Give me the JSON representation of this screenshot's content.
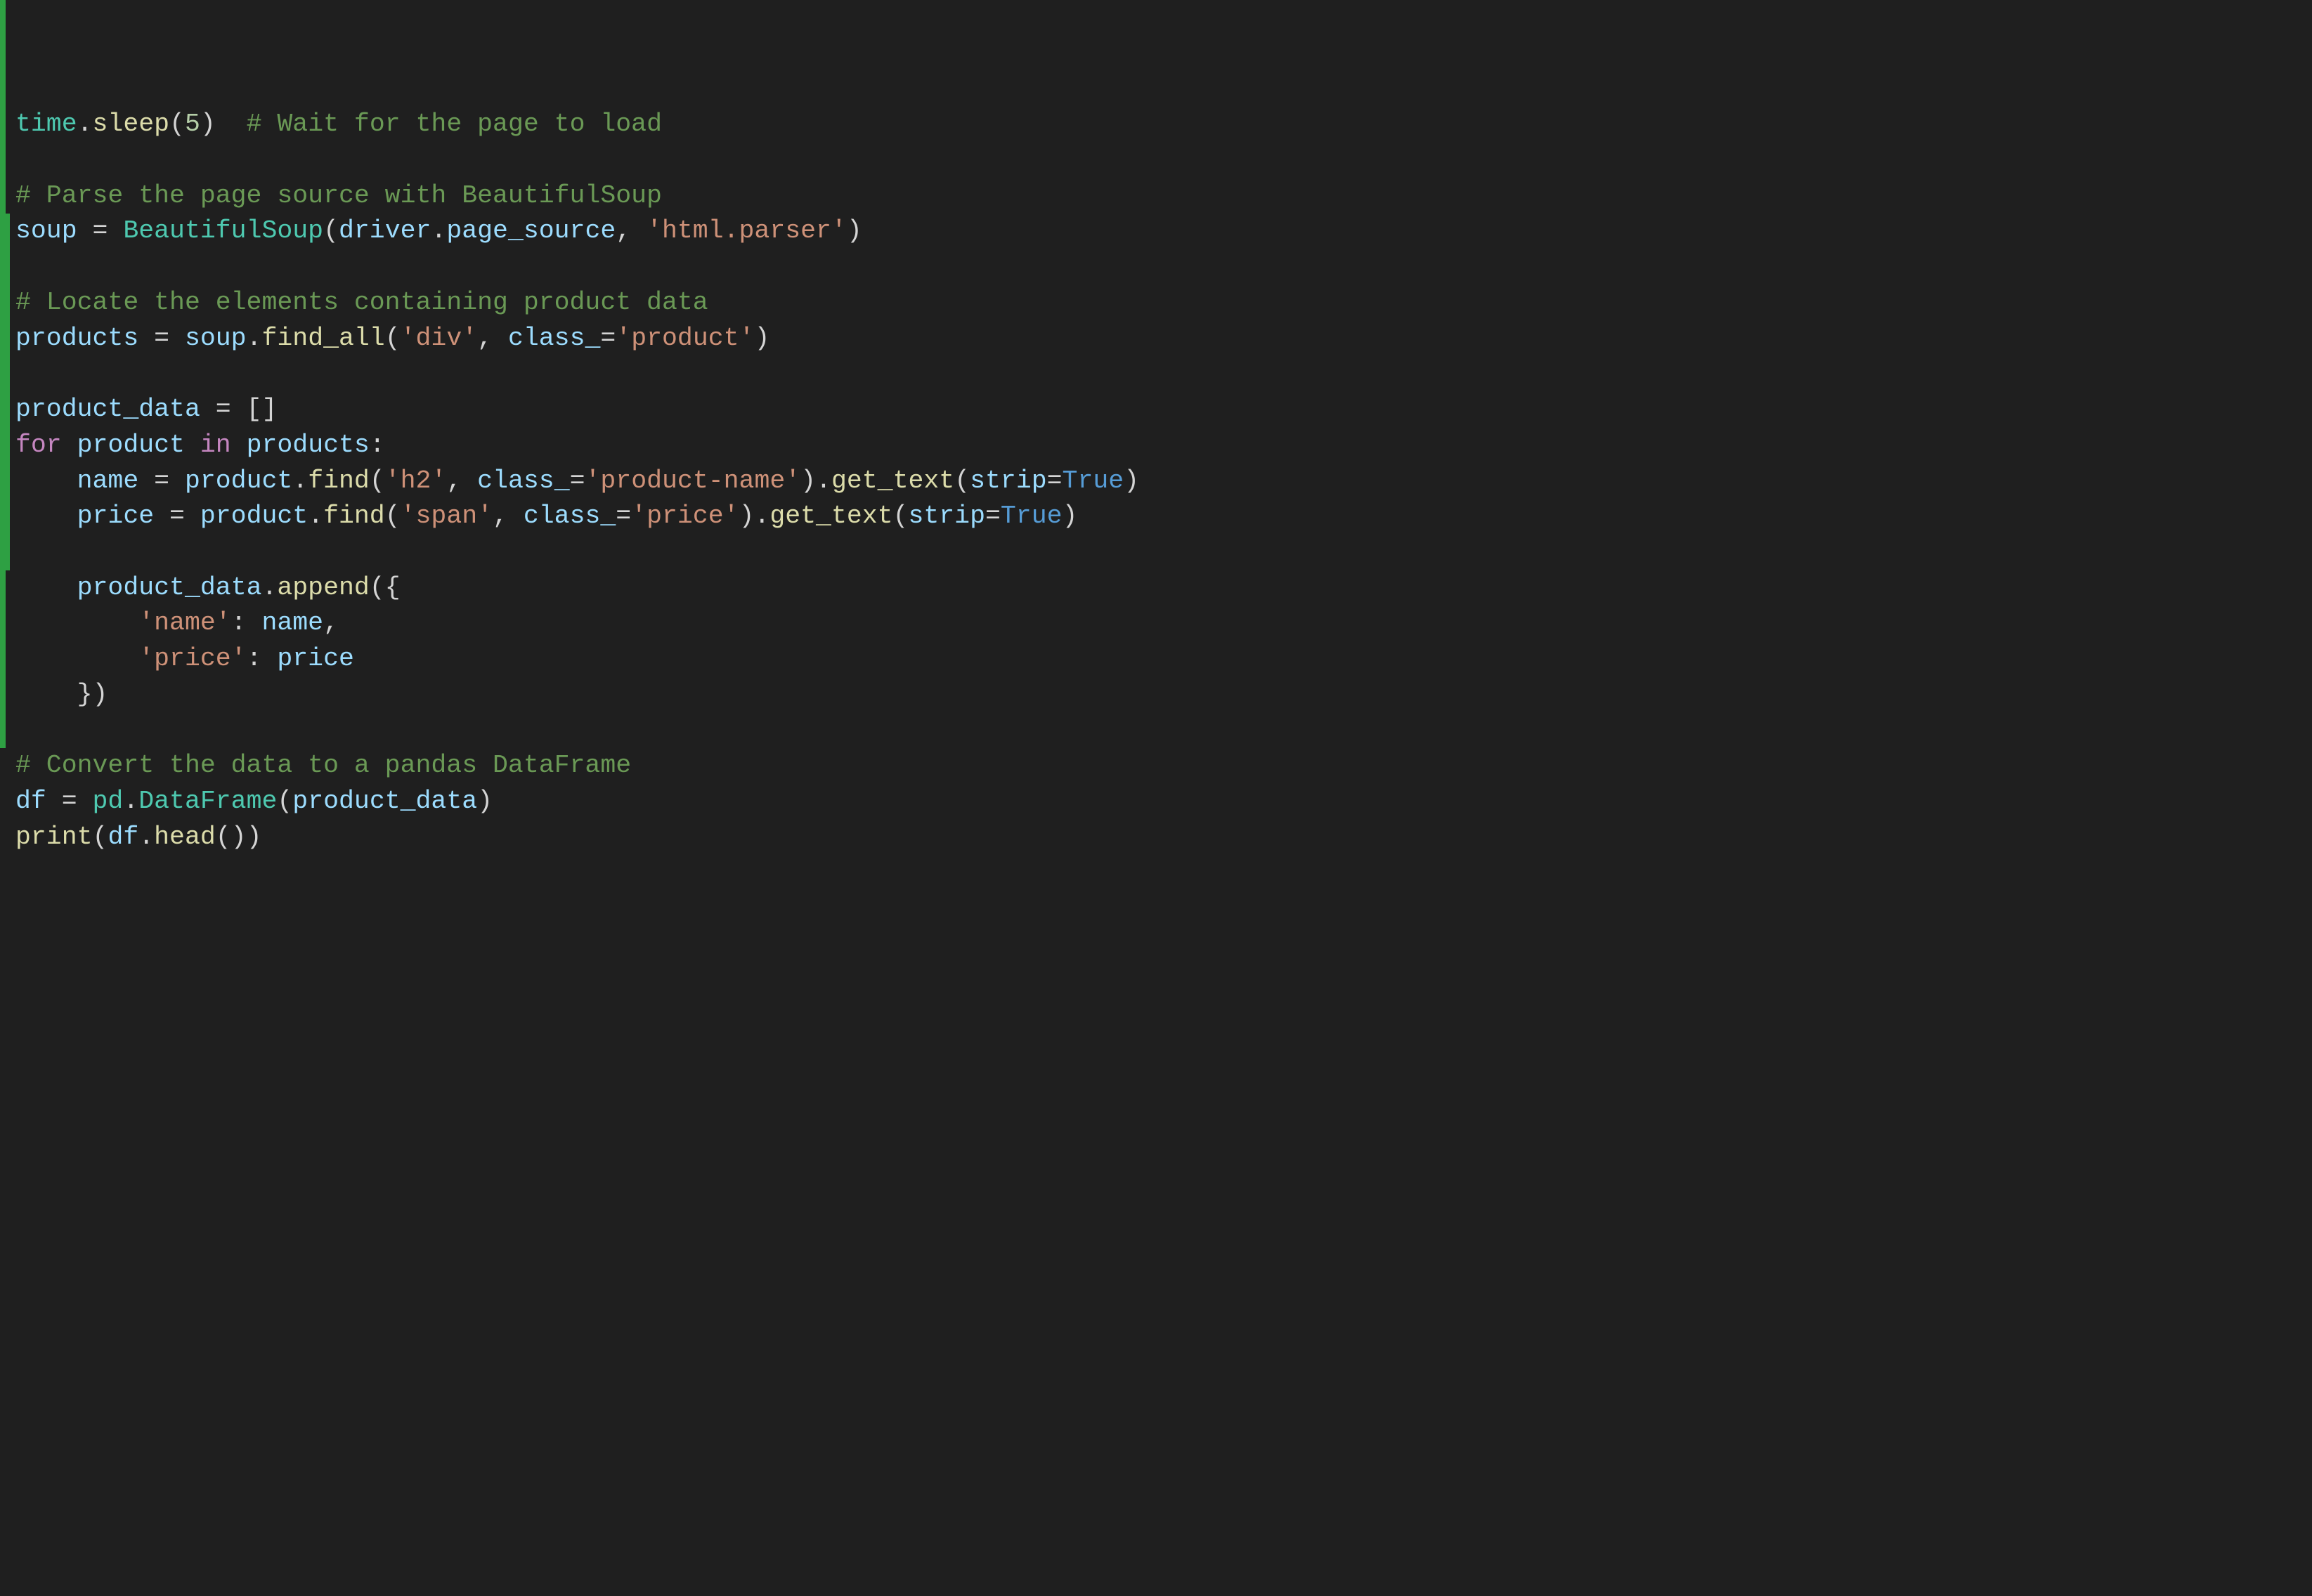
{
  "code": {
    "lines": [
      [
        {
          "t": "time",
          "c": "tk-mod"
        },
        {
          "t": ".",
          "c": "tk-op"
        },
        {
          "t": "sleep",
          "c": "tk-fn"
        },
        {
          "t": "(",
          "c": "tk-op"
        },
        {
          "t": "5",
          "c": "tk-num"
        },
        {
          "t": ")  ",
          "c": "tk-op"
        },
        {
          "t": "# Wait for the page to load",
          "c": "tk-cmt"
        }
      ],
      [],
      [
        {
          "t": "# Parse the page source with BeautifulSoup",
          "c": "tk-cmt"
        }
      ],
      [
        {
          "t": "soup ",
          "c": "tk-var"
        },
        {
          "t": "= ",
          "c": "tk-op"
        },
        {
          "t": "BeautifulSoup",
          "c": "tk-mod"
        },
        {
          "t": "(",
          "c": "tk-op"
        },
        {
          "t": "driver",
          "c": "tk-var"
        },
        {
          "t": ".",
          "c": "tk-op"
        },
        {
          "t": "page_source",
          "c": "tk-var"
        },
        {
          "t": ", ",
          "c": "tk-op"
        },
        {
          "t": "'html.parser'",
          "c": "tk-str"
        },
        {
          "t": ")",
          "c": "tk-op"
        }
      ],
      [],
      [
        {
          "t": "# Locate the elements containing product data",
          "c": "tk-cmt"
        }
      ],
      [
        {
          "t": "products ",
          "c": "tk-var"
        },
        {
          "t": "= ",
          "c": "tk-op"
        },
        {
          "t": "soup",
          "c": "tk-var"
        },
        {
          "t": ".",
          "c": "tk-op"
        },
        {
          "t": "find_all",
          "c": "tk-fn"
        },
        {
          "t": "(",
          "c": "tk-op"
        },
        {
          "t": "'div'",
          "c": "tk-str"
        },
        {
          "t": ", ",
          "c": "tk-op"
        },
        {
          "t": "class_",
          "c": "tk-param"
        },
        {
          "t": "=",
          "c": "tk-op"
        },
        {
          "t": "'product'",
          "c": "tk-str"
        },
        {
          "t": ")",
          "c": "tk-op"
        }
      ],
      [],
      [
        {
          "t": "product_data ",
          "c": "tk-var"
        },
        {
          "t": "= []",
          "c": "tk-op"
        }
      ],
      [
        {
          "t": "for ",
          "c": "tk-kw"
        },
        {
          "t": "product ",
          "c": "tk-var"
        },
        {
          "t": "in ",
          "c": "tk-kw"
        },
        {
          "t": "products",
          "c": "tk-var"
        },
        {
          "t": ":",
          "c": "tk-op"
        }
      ],
      [
        {
          "t": "    ",
          "c": "tk-plain"
        },
        {
          "t": "name ",
          "c": "tk-var"
        },
        {
          "t": "= ",
          "c": "tk-op"
        },
        {
          "t": "product",
          "c": "tk-var"
        },
        {
          "t": ".",
          "c": "tk-op"
        },
        {
          "t": "find",
          "c": "tk-fn"
        },
        {
          "t": "(",
          "c": "tk-op"
        },
        {
          "t": "'h2'",
          "c": "tk-str"
        },
        {
          "t": ", ",
          "c": "tk-op"
        },
        {
          "t": "class_",
          "c": "tk-param"
        },
        {
          "t": "=",
          "c": "tk-op"
        },
        {
          "t": "'product-name'",
          "c": "tk-str"
        },
        {
          "t": ").",
          "c": "tk-op"
        },
        {
          "t": "get_text",
          "c": "tk-fn"
        },
        {
          "t": "(",
          "c": "tk-op"
        },
        {
          "t": "strip",
          "c": "tk-param"
        },
        {
          "t": "=",
          "c": "tk-op"
        },
        {
          "t": "True",
          "c": "tk-const"
        },
        {
          "t": ")",
          "c": "tk-op"
        }
      ],
      [
        {
          "t": "    ",
          "c": "tk-plain"
        },
        {
          "t": "price ",
          "c": "tk-var"
        },
        {
          "t": "= ",
          "c": "tk-op"
        },
        {
          "t": "product",
          "c": "tk-var"
        },
        {
          "t": ".",
          "c": "tk-op"
        },
        {
          "t": "find",
          "c": "tk-fn"
        },
        {
          "t": "(",
          "c": "tk-op"
        },
        {
          "t": "'span'",
          "c": "tk-str"
        },
        {
          "t": ", ",
          "c": "tk-op"
        },
        {
          "t": "class_",
          "c": "tk-param"
        },
        {
          "t": "=",
          "c": "tk-op"
        },
        {
          "t": "'price'",
          "c": "tk-str"
        },
        {
          "t": ").",
          "c": "tk-op"
        },
        {
          "t": "get_text",
          "c": "tk-fn"
        },
        {
          "t": "(",
          "c": "tk-op"
        },
        {
          "t": "strip",
          "c": "tk-param"
        },
        {
          "t": "=",
          "c": "tk-op"
        },
        {
          "t": "True",
          "c": "tk-const"
        },
        {
          "t": ")",
          "c": "tk-op"
        }
      ],
      [],
      [
        {
          "t": "    ",
          "c": "tk-plain"
        },
        {
          "t": "product_data",
          "c": "tk-var"
        },
        {
          "t": ".",
          "c": "tk-op"
        },
        {
          "t": "append",
          "c": "tk-fn"
        },
        {
          "t": "({",
          "c": "tk-op"
        }
      ],
      [
        {
          "t": "        ",
          "c": "tk-plain"
        },
        {
          "t": "'name'",
          "c": "tk-str"
        },
        {
          "t": ": ",
          "c": "tk-op"
        },
        {
          "t": "name",
          "c": "tk-var"
        },
        {
          "t": ",",
          "c": "tk-op"
        }
      ],
      [
        {
          "t": "        ",
          "c": "tk-plain"
        },
        {
          "t": "'price'",
          "c": "tk-str"
        },
        {
          "t": ": ",
          "c": "tk-op"
        },
        {
          "t": "price",
          "c": "tk-var"
        }
      ],
      [
        {
          "t": "    })",
          "c": "tk-op"
        }
      ],
      [],
      [
        {
          "t": "# Convert the data to a pandas DataFrame",
          "c": "tk-cmt"
        }
      ],
      [
        {
          "t": "df ",
          "c": "tk-var"
        },
        {
          "t": "= ",
          "c": "tk-op"
        },
        {
          "t": "pd",
          "c": "tk-mod"
        },
        {
          "t": ".",
          "c": "tk-op"
        },
        {
          "t": "DataFrame",
          "c": "tk-mod"
        },
        {
          "t": "(",
          "c": "tk-op"
        },
        {
          "t": "product_data",
          "c": "tk-var"
        },
        {
          "t": ")",
          "c": "tk-op"
        }
      ],
      [
        {
          "t": "print",
          "c": "tk-fn"
        },
        {
          "t": "(",
          "c": "tk-op"
        },
        {
          "t": "df",
          "c": "tk-var"
        },
        {
          "t": ".",
          "c": "tk-op"
        },
        {
          "t": "head",
          "c": "tk-fn"
        },
        {
          "t": "())",
          "c": "tk-op"
        }
      ]
    ]
  },
  "diff": {
    "thin": [
      {
        "start": 0,
        "end": 6
      },
      {
        "start": 16,
        "end": 21
      }
    ],
    "thick": [
      {
        "start": 6,
        "end": 16
      }
    ]
  }
}
